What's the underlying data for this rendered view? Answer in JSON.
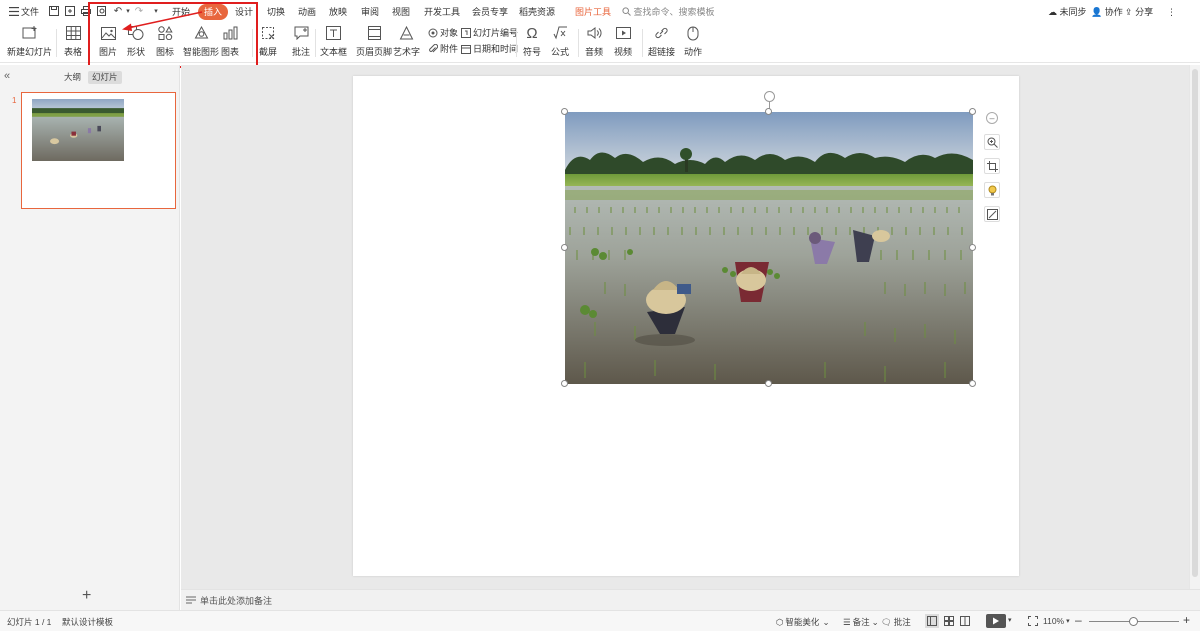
{
  "menubar": {
    "file_label": "文件",
    "tabs": [
      {
        "label": "开始"
      },
      {
        "label": "插入"
      },
      {
        "label": "设计"
      },
      {
        "label": "切换"
      },
      {
        "label": "动画"
      },
      {
        "label": "放映"
      },
      {
        "label": "审阅"
      },
      {
        "label": "视图"
      },
      {
        "label": "开发工具"
      },
      {
        "label": "会员专享"
      },
      {
        "label": "稻壳资源"
      },
      {
        "label": "图片工具"
      }
    ],
    "search_placeholder": "查找命令、搜索模板",
    "sync_label": "未同步",
    "collab_label": "协作",
    "share_label": "分享",
    "more_label": "⋮",
    "accent_color": "#e8663d"
  },
  "ribbon": {
    "new_slide": "新建幻灯片",
    "table": "表格",
    "picture": "图片",
    "shape": "形状",
    "icon": "图标",
    "smartart": "智能图形",
    "chart": "图表",
    "screenshot": "截屏",
    "comment": "批注",
    "textbox": "文本框",
    "header_footer": "页眉页脚",
    "wordart": "艺术字",
    "object": "对象",
    "attachment": "附件",
    "slide_number": "幻灯片编号",
    "date_time": "日期和时间",
    "symbol": "符号",
    "formula": "公式",
    "audio": "音频",
    "video": "视频",
    "hyperlink": "超链接",
    "action": "动作"
  },
  "leftpanel": {
    "outline_tab": "大纲",
    "slides_tab": "幻灯片",
    "slide_number": "1",
    "add_label": "+"
  },
  "notes": {
    "placeholder": "单击此处添加备注"
  },
  "statusbar": {
    "slide_info": "幻灯片 1 / 1",
    "template": "默认设计模板",
    "smart_beautify": "智能美化",
    "notes": "备注",
    "comments": "批注",
    "zoom": "110%"
  }
}
